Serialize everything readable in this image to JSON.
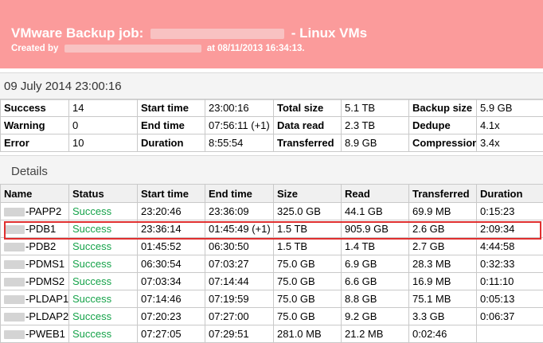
{
  "header": {
    "title_prefix": "VMware Backup job:",
    "title_suffix": "- Linux VMs",
    "subtitle_prefix": "Created by",
    "subtitle_suffix": "at 08/11/2013 16:34:13.",
    "bg_color": "#fb9b9b"
  },
  "session": {
    "date": "09 July 2014 23:00:16"
  },
  "summary": {
    "rows": [
      [
        "Success",
        "14",
        "Start time",
        "23:00:16",
        "Total size",
        "5.1 TB",
        "Backup size",
        "5.9 GB"
      ],
      [
        "Warning",
        "0",
        "End time",
        "07:56:11 (+1)",
        "Data read",
        "2.3 TB",
        "Dedupe",
        "4.1x"
      ],
      [
        "Error",
        "10",
        "Duration",
        "8:55:54",
        "Transferred",
        "8.9 GB",
        "Compression",
        "3.4x"
      ]
    ]
  },
  "details": {
    "heading": "Details",
    "columns": [
      "Name",
      "Status",
      "Start time",
      "End time",
      "Size",
      "Read",
      "Transferred",
      "Duration"
    ],
    "rows": [
      [
        "-PAPP2",
        "Success",
        "23:20:46",
        "23:36:09",
        "325.0 GB",
        "44.1 GB",
        "69.9 MB",
        "0:15:23"
      ],
      [
        "-PDB1",
        "Success",
        "23:36:14",
        "01:45:49 (+1)",
        "1.5 TB",
        "905.9 GB",
        "2.6 GB",
        "2:09:34"
      ],
      [
        "-PDB2",
        "Success",
        "01:45:52",
        "06:30:50",
        "1.5 TB",
        "1.4 TB",
        "2.7 GB",
        "4:44:58"
      ],
      [
        "-PDMS1",
        "Success",
        "06:30:54",
        "07:03:27",
        "75.0 GB",
        "6.9 GB",
        "28.3 MB",
        "0:32:33"
      ],
      [
        "-PDMS2",
        "Success",
        "07:03:34",
        "07:14:44",
        "75.0 GB",
        "6.6 GB",
        "16.9 MB",
        "0:11:10"
      ],
      [
        "-PLDAP1",
        "Success",
        "07:14:46",
        "07:19:59",
        "75.0 GB",
        "8.8 GB",
        "75.1 MB",
        "0:05:13"
      ],
      [
        "-PLDAP2",
        "Success",
        "07:20:23",
        "07:27:00",
        "75.0 GB",
        "9.2 GB",
        "3.3 GB",
        "0:06:37"
      ],
      [
        "-PWEB1",
        "Success",
        "07:27:05",
        "07:29:51",
        "281.0 MB",
        "21.2 MB",
        "0:02:46",
        ""
      ]
    ],
    "status_color": "#16a34a",
    "highlight_color": "#e03030"
  }
}
